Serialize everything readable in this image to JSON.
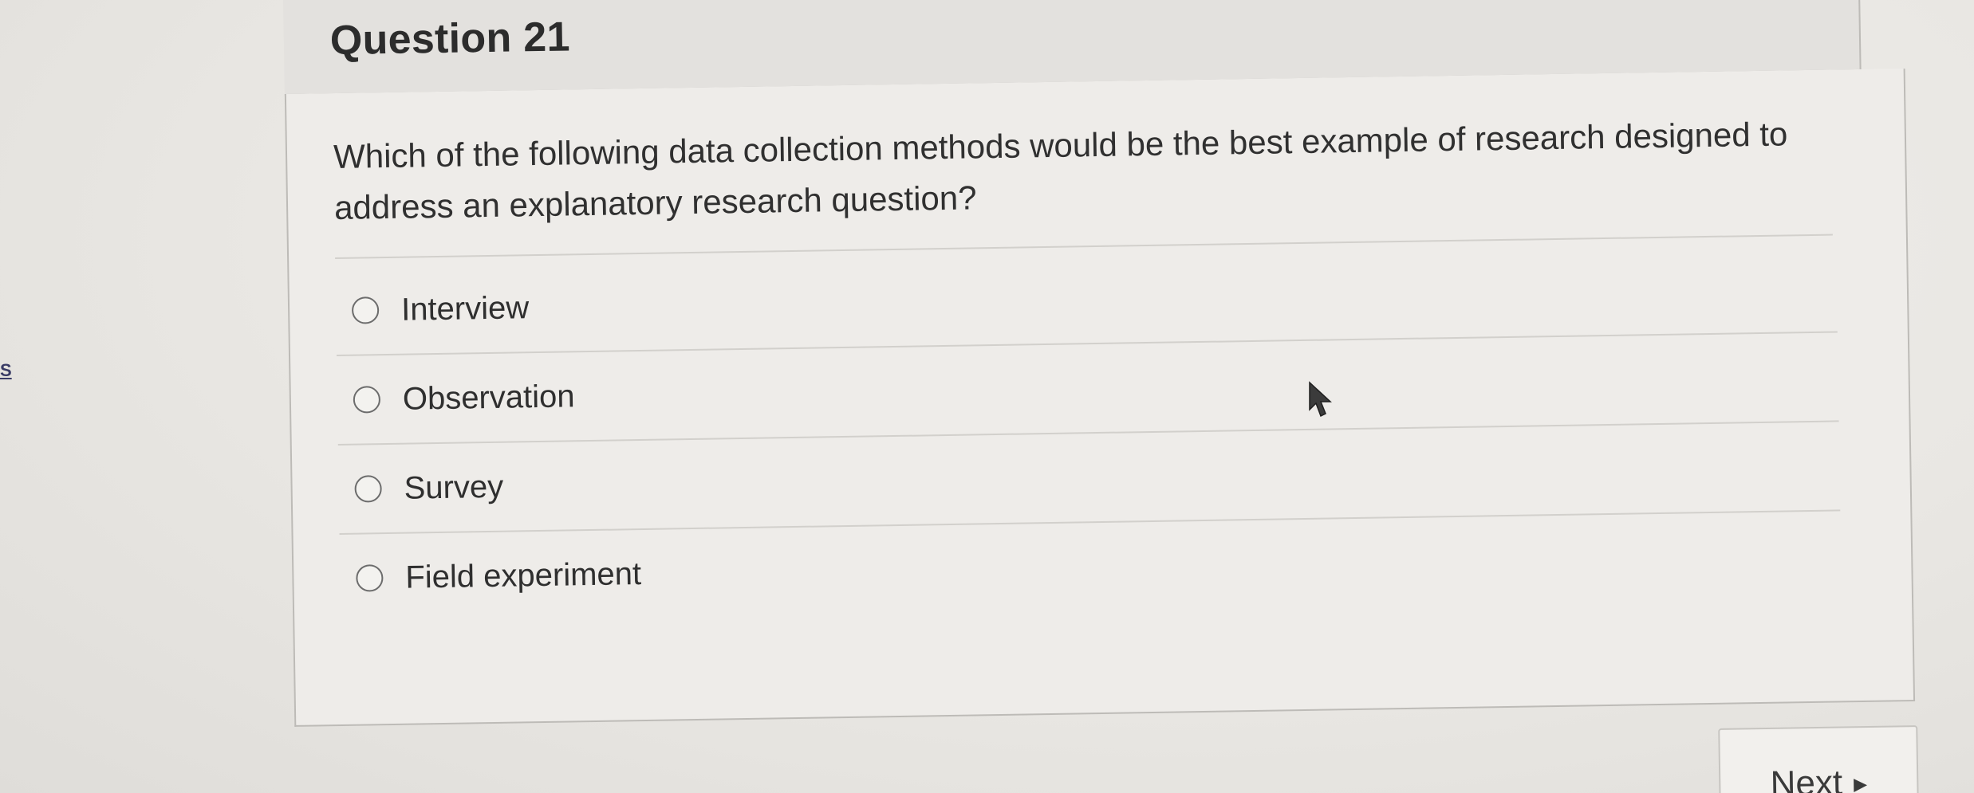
{
  "side_mark": "S",
  "question": {
    "title": "Question 21",
    "text": "Which of the following data collection methods would be the best example of research designed to address an explanatory research question?",
    "options": [
      {
        "label": "Interview",
        "selected": false
      },
      {
        "label": "Observation",
        "selected": false
      },
      {
        "label": "Survey",
        "selected": false
      },
      {
        "label": "Field experiment",
        "selected": false
      }
    ]
  },
  "navigation": {
    "next_label": "Next",
    "next_icon": "triangle-right-icon"
  },
  "colors": {
    "background": "#e7e5e2",
    "card": "#eeece9",
    "text": "#2c2c2c",
    "border": "#bdbbb7"
  }
}
